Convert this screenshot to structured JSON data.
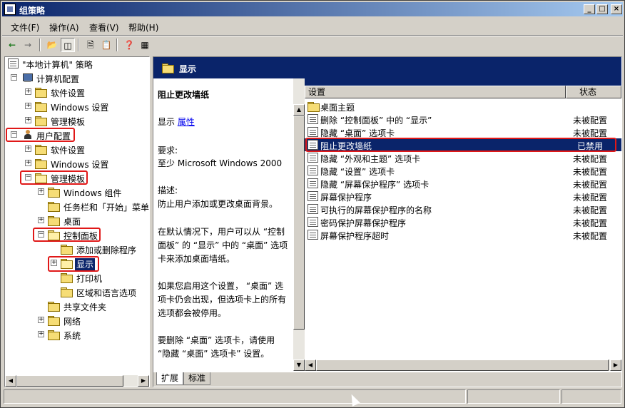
{
  "window": {
    "title": "组策略",
    "controls": [
      "_",
      "□",
      "×"
    ]
  },
  "menu": {
    "items": [
      "文件(F)",
      "操作(A)",
      "查看(V)",
      "帮助(H)"
    ]
  },
  "toolbar": {
    "icons": [
      "back-arrow-icon",
      "forward-arrow-icon",
      "up-folder-icon",
      "show-tree-icon",
      "properties-icon",
      "export-list-icon",
      "help-icon",
      "console-tree-icon"
    ]
  },
  "tree": {
    "root": "\"本地计算机\" 策略",
    "computer_config": "计算机配置",
    "computer_children": [
      "软件设置",
      "Windows 设置",
      "管理模板"
    ],
    "user_config": "用户配置",
    "user_children": [
      "软件设置",
      "Windows 设置"
    ],
    "admin_templates": "管理模板",
    "admin_children_a": [
      "Windows 组件",
      "任务栏和「开始」菜单",
      "桌面"
    ],
    "control_panel": "控制面板",
    "cp_children_a": [
      "添加或删除程序"
    ],
    "display": "显示",
    "cp_children_b": [
      "打印机",
      "区域和语言选项"
    ],
    "admin_children_b": [
      "共享文件夹",
      "网络",
      "系统"
    ]
  },
  "header": {
    "title": "显示"
  },
  "description": {
    "title": "阻止更改墙纸",
    "display_label": "显示",
    "properties_link": "属性",
    "requirements_label": "要求:",
    "requirements": "至少 Microsoft Windows 2000",
    "desc_label": "描述:",
    "desc_1": "防止用户添加或更改桌面背景。",
    "desc_2": "在默认情况下，用户可以从 “控制面板” 的 “显示” 中的 “桌面” 选项卡来添加桌面墙纸。",
    "desc_3": "如果您启用这个设置， “桌面” 选项卡仍会出现，但选项卡上的所有选项都会被停用。",
    "desc_4": "要删除 “桌面” 选项卡，请使用 “隐藏 “桌面” 选项卡” 设置。"
  },
  "list": {
    "col_setting": "设置",
    "col_state": "状态",
    "rows": [
      {
        "name": "桌面主题",
        "state": ""
      },
      {
        "name": "删除 “控制面板” 中的 “显示”",
        "state": "未被配置"
      },
      {
        "name": "隐藏 “桌面” 选项卡",
        "state": "未被配置"
      },
      {
        "name": "阻止更改墙纸",
        "state": "已禁用"
      },
      {
        "name": "隐藏 “外观和主题” 选项卡",
        "state": "未被配置"
      },
      {
        "name": "隐藏 “设置” 选项卡",
        "state": "未被配置"
      },
      {
        "name": "隐藏 “屏幕保护程序” 选项卡",
        "state": "未被配置"
      },
      {
        "name": "屏幕保护程序",
        "state": "未被配置"
      },
      {
        "name": "可执行的屏幕保护程序的名称",
        "state": "未被配置"
      },
      {
        "name": "密码保护屏幕保护程序",
        "state": "未被配置"
      },
      {
        "name": "屏幕保护程序超时",
        "state": "未被配置"
      }
    ]
  },
  "tabs": [
    "扩展",
    "标准"
  ]
}
